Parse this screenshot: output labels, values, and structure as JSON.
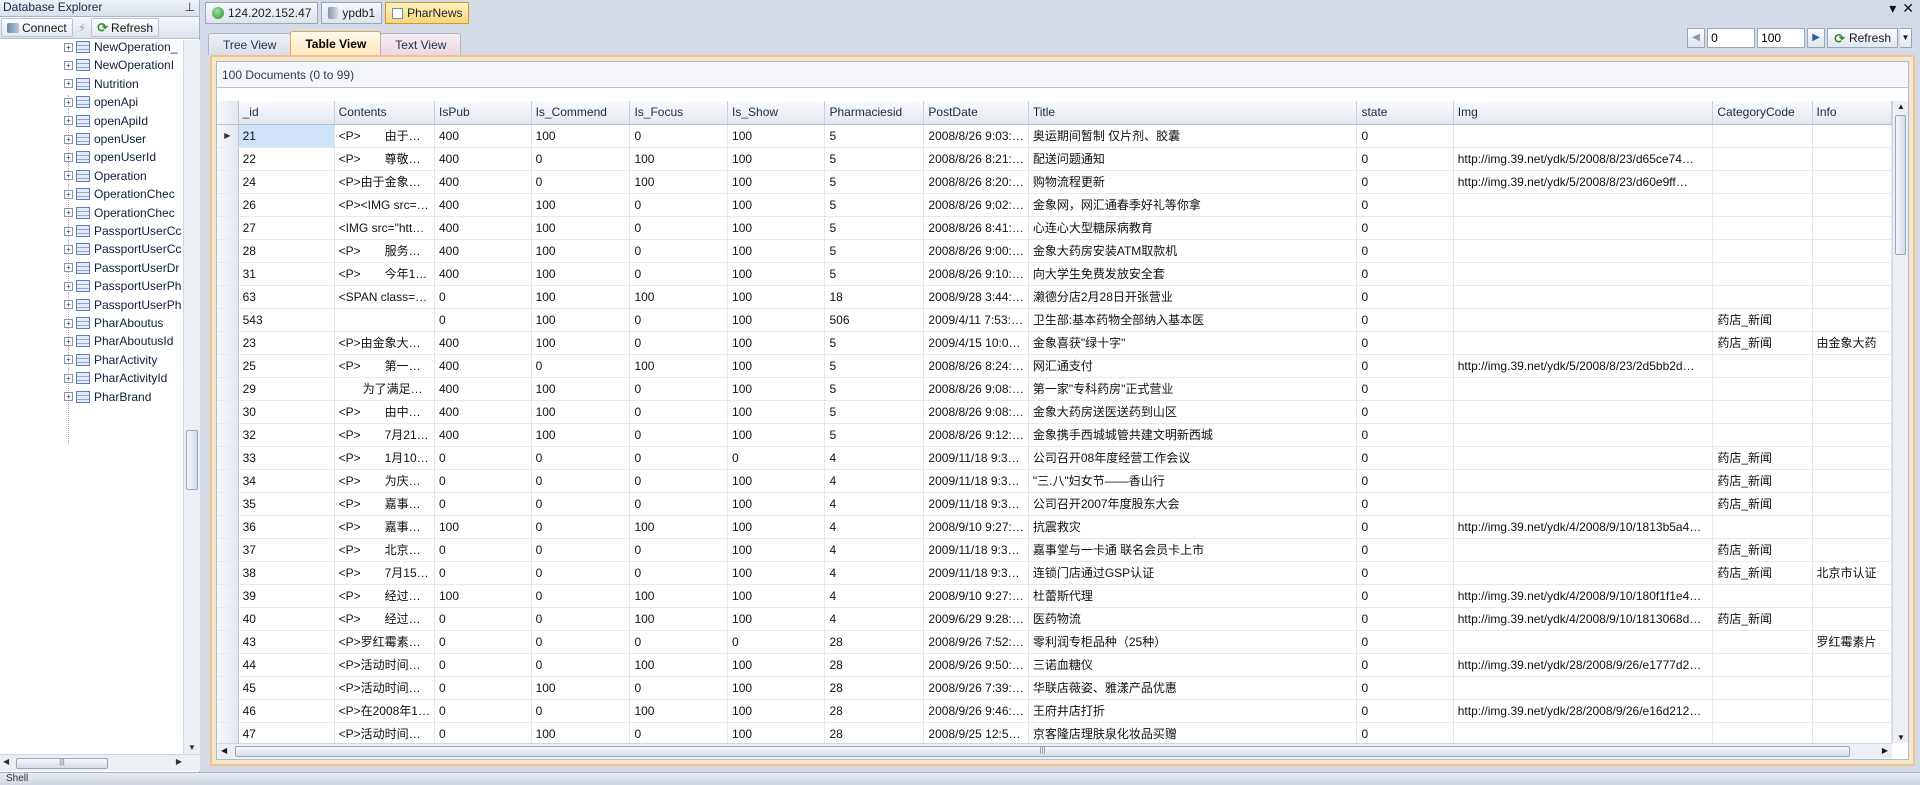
{
  "explorer": {
    "title": "Database Explorer",
    "connect_label": "Connect",
    "refresh_label": "Refresh",
    "tree_items": [
      "NewOperation_",
      "NewOperationI",
      "Nutrition",
      "openApi",
      "openApiId",
      "openUser",
      "openUserId",
      "Operation",
      "OperationChec",
      "OperationChec",
      "PassportUserCc",
      "PassportUserCc",
      "PassportUserDr",
      "PassportUserPh",
      "PassportUserPh",
      "PharAboutus",
      "PharAboutusId",
      "PharActivity",
      "PharActivityId",
      "PharBrand"
    ]
  },
  "doc_tabs": {
    "server": "124.202.152.47",
    "database": "ypdb1",
    "collection": "PharNews"
  },
  "view_tabs": {
    "tree": "Tree View",
    "table": "Table View",
    "text": "Text View"
  },
  "pager": {
    "skip": "0",
    "limit": "100",
    "refresh_label": "Refresh"
  },
  "status": {
    "doc_count": "100 Documents (0 to 99)",
    "bottom": "Shell"
  },
  "colors": {
    "active_tab": "#f7d77a",
    "grid_border": "#f1c48a",
    "selected_cell": "#cfe3fb"
  },
  "table": {
    "columns": [
      "_id",
      "Contents",
      "IsPub",
      "Is_Commend",
      "Is_Focus",
      "Is_Show",
      "Pharmaciesid",
      "PostDate",
      "Title",
      "state",
      "Img",
      "CategoryCode",
      "Info"
    ],
    "rows": [
      [
        "21",
        "<P>　　由于…",
        "400",
        "100",
        "0",
        "100",
        "5",
        "2008/8/26 9:03:…",
        "奥运期间暂制 仅片剂、胶囊",
        "0",
        "",
        "",
        ""
      ],
      [
        "22",
        "<P>　　尊敬…",
        "400",
        "0",
        "100",
        "100",
        "5",
        "2008/8/26 8:21:…",
        "配送问题通知",
        "0",
        "http://img.39.net/ydk/5/2008/8/23/d65ce74…",
        "",
        ""
      ],
      [
        "24",
        "<P>由于金象…",
        "400",
        "0",
        "100",
        "100",
        "5",
        "2008/8/26 8:20:…",
        "购物流程更新",
        "0",
        "http://img.39.net/ydk/5/2008/8/23/d60e9ff…",
        "",
        ""
      ],
      [
        "26",
        "<P><IMG src=…",
        "400",
        "100",
        "0",
        "100",
        "5",
        "2008/8/26 9:02:…",
        "金象网，网汇通春季好礼等你拿",
        "0",
        "",
        "",
        ""
      ],
      [
        "27",
        "<IMG src=\"htt…",
        "400",
        "100",
        "0",
        "100",
        "5",
        "2008/8/26 8:41:…",
        "心连心大型糖尿病教育",
        "0",
        "",
        "",
        ""
      ],
      [
        "28",
        "<P>　　服务…",
        "400",
        "100",
        "0",
        "100",
        "5",
        "2008/8/26 9:00:…",
        "金象大药房安装ATM取款机",
        "0",
        "",
        "",
        ""
      ],
      [
        "31",
        "<P>　　今年1…",
        "400",
        "100",
        "0",
        "100",
        "5",
        "2008/8/26 9:10:…",
        "向大学生免费发放安全套",
        "0",
        "",
        "",
        ""
      ],
      [
        "63",
        "<SPAN class=…",
        "0",
        "100",
        "100",
        "100",
        "18",
        "2008/9/28 3:44:…",
        "濑德分店2月28日开张营业",
        "0",
        "",
        "",
        ""
      ],
      [
        "543",
        "",
        "0",
        "100",
        "0",
        "100",
        "506",
        "2009/4/11 7:53:…",
        "卫生部:基本药物全部纳入基本医",
        "0",
        "",
        "药店_新闻",
        ""
      ],
      [
        "23",
        "<P>由金象大…",
        "400",
        "100",
        "0",
        "100",
        "5",
        "2009/4/15 10:0…",
        "金象喜获\"绿十字\"",
        "0",
        "",
        "药店_新闻",
        "由金象大药"
      ],
      [
        "25",
        "<P>　　第一…",
        "400",
        "0",
        "100",
        "100",
        "5",
        "2008/8/26 8:24:…",
        "网汇通支付",
        "0",
        "http://img.39.net/ydk/5/2008/8/23/2d5bb2d…",
        "",
        ""
      ],
      [
        "29",
        "　　为了满足…",
        "400",
        "100",
        "0",
        "100",
        "5",
        "2008/8/26 9:08:…",
        "第一家\"专科药房\"正式营业",
        "0",
        "",
        "",
        ""
      ],
      [
        "30",
        "<P>　　由中…",
        "400",
        "100",
        "0",
        "100",
        "5",
        "2008/8/26 9:08:…",
        "金象大药房送医送药到山区",
        "0",
        "",
        "",
        ""
      ],
      [
        "32",
        "<P>　　7月21…",
        "400",
        "100",
        "0",
        "100",
        "5",
        "2008/8/26 9:12:…",
        "金象携手西城城管共建文明新西城",
        "0",
        "",
        "",
        ""
      ],
      [
        "33",
        "<P>　　1月10…",
        "0",
        "0",
        "0",
        "0",
        "4",
        "2009/11/18 9:3…",
        "公司召开08年度经营工作会议",
        "0",
        "",
        "药店_新闻",
        ""
      ],
      [
        "34",
        "<P>　　为庆…",
        "0",
        "0",
        "0",
        "100",
        "4",
        "2009/11/18 9:3…",
        "\"三.八\"妇女节——香山行",
        "0",
        "",
        "药店_新闻",
        ""
      ],
      [
        "35",
        "<P>　　嘉事…",
        "0",
        "0",
        "0",
        "100",
        "4",
        "2009/11/18 9:3…",
        "公司召开2007年度股东大会",
        "0",
        "",
        "药店_新闻",
        ""
      ],
      [
        "36",
        "<P>　　嘉事…",
        "100",
        "0",
        "100",
        "100",
        "4",
        "2008/9/10 9:27:…",
        "抗震救灾",
        "0",
        "http://img.39.net/ydk/4/2008/9/10/1813b5a4…",
        "",
        ""
      ],
      [
        "37",
        "<P>　　北京…",
        "0",
        "0",
        "0",
        "100",
        "4",
        "2009/11/18 9:3…",
        "嘉事堂与一卡通 联名会员卡上市",
        "0",
        "",
        "药店_新闻",
        ""
      ],
      [
        "38",
        "<P>　　7月15…",
        "0",
        "0",
        "0",
        "100",
        "4",
        "2009/11/18 9:3…",
        "连锁门店通过GSP认证",
        "0",
        "",
        "药店_新闻",
        "北京市认证"
      ],
      [
        "39",
        "<P>　　经过…",
        "100",
        "0",
        "100",
        "100",
        "4",
        "2008/9/10 9:27:…",
        "杜蕾斯代理",
        "0",
        "http://img.39.net/ydk/4/2008/9/10/180f1f1e4…",
        "",
        ""
      ],
      [
        "40",
        "<P>　　经过…",
        "0",
        "0",
        "100",
        "100",
        "4",
        "2009/6/29 9:28:…",
        "医药物流",
        "0",
        "http://img.39.net/ydk/4/2008/9/10/1813068d…",
        "药店_新闻",
        ""
      ],
      [
        "43",
        "<P>罗红霉素…",
        "0",
        "0",
        "0",
        "0",
        "28",
        "2008/9/26 7:52:…",
        "零利润专柜品种（25种）",
        "0",
        "",
        "",
        "罗红霉素片"
      ],
      [
        "44",
        "<P>活动时间…",
        "0",
        "0",
        "100",
        "100",
        "28",
        "2008/9/26 9:50:…",
        "三诺血糖仪",
        "0",
        "http://img.39.net/ydk/28/2008/9/26/e1777d2…",
        "",
        ""
      ],
      [
        "45",
        "<P>活动时间…",
        "0",
        "100",
        "0",
        "100",
        "28",
        "2008/9/26 7:39:…",
        "华联店薇姿、雅漾产品优惠",
        "0",
        "",
        "",
        ""
      ],
      [
        "46",
        "<P>在2008年1…",
        "0",
        "0",
        "100",
        "100",
        "28",
        "2008/9/26 9:46:…",
        "王府井店打折",
        "0",
        "http://img.39.net/ydk/28/2008/9/26/e16d212…",
        "",
        ""
      ],
      [
        "47",
        "<P>活动时间…",
        "0",
        "100",
        "0",
        "100",
        "28",
        "2008/9/25 12:5…",
        "京客隆店理肤泉化妆品买赠",
        "0",
        "",
        "",
        ""
      ]
    ]
  }
}
